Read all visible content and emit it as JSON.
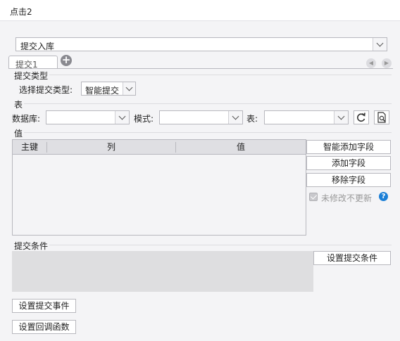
{
  "window": {
    "title": "点击2"
  },
  "action_select": {
    "value": "提交入库"
  },
  "tabs": [
    {
      "label": "提交1"
    }
  ],
  "submit_type": {
    "section_label": "提交类型",
    "field_label": "选择提交类型:",
    "value": "智能提交"
  },
  "table_section": {
    "section_label": "表",
    "database_label": "数据库:",
    "database_value": "",
    "schema_label": "模式:",
    "schema_value": "",
    "table_label": "表:",
    "table_value": ""
  },
  "values_section": {
    "section_label": "值",
    "columns": [
      "主键",
      "列",
      "值"
    ],
    "rows": [],
    "buttons": {
      "smart_add": "智能添加字段",
      "add": "添加字段",
      "remove": "移除字段"
    },
    "no_update_checkbox": {
      "label": "未修改不更新",
      "checked": true,
      "disabled": true
    }
  },
  "condition_section": {
    "section_label": "提交条件",
    "set_button": "设置提交条件"
  },
  "bottom_buttons": {
    "set_event": "设置提交事件",
    "set_callback": "设置回调函数"
  },
  "icons": {
    "add_tab": "plus-circle-icon",
    "refresh": "refresh-icon",
    "preview": "document-search-icon",
    "help": "question-circle-icon",
    "nav_prev": "chevron-left-icon",
    "nav_next": "chevron-right-icon"
  },
  "colors": {
    "help_icon": "#1b7fd6",
    "background": "#f4f4f6"
  }
}
